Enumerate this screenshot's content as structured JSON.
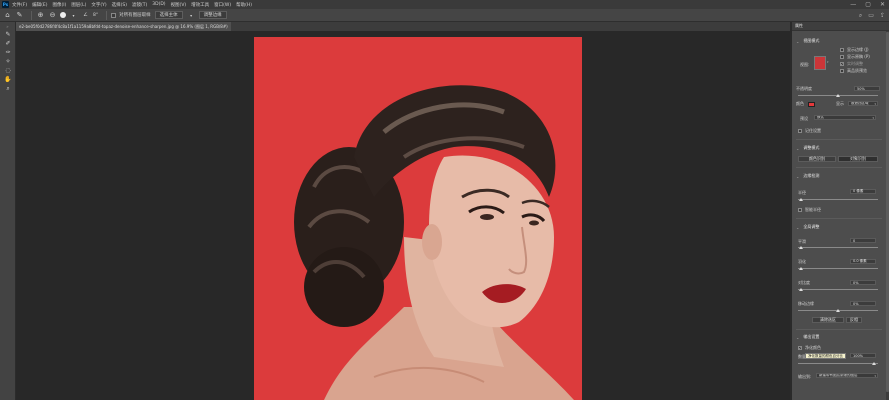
{
  "menubar": {
    "logo": "Ps",
    "items": [
      "文件(F)",
      "编辑(E)",
      "图像(I)",
      "图层(L)",
      "文字(Y)",
      "选择(S)",
      "滤镜(T)",
      "3D(D)",
      "视图(V)",
      "增效工具",
      "窗口(W)",
      "帮助(H)"
    ],
    "controls": [
      "—",
      "▢",
      "✕"
    ]
  },
  "options": {
    "size_value": "8°",
    "sample_button": "对所有图层取样",
    "select_subject": "选择主体",
    "refine_edge": "调整边缘"
  },
  "document": {
    "tab_title": "e2-be05f0d2786f4f4c8a1f1a1159a8bfdd-topaz-denoise-enhance-sharpen.jpg @ 16.9% (图层 1, RGB/8#)",
    "close": "×"
  },
  "panel": {
    "title": "属性",
    "view_mode": "视图模式",
    "show_edge": "显示边缘 (J)",
    "show_original": "显示原稿 (P)",
    "realtime": "实时调整",
    "high_quality": "高品质预览",
    "view_label": "视图:",
    "transparency_label": "不透明度",
    "transparency_value": "50%",
    "color_label": "颜色",
    "show_label": "显示",
    "show_value": "被遮挡区域",
    "preset_label": "预设",
    "preset_value": "默认",
    "remember": "记住设置",
    "adjust_mode": "调整模式",
    "color_aware": "颜色识别",
    "object_aware": "对象识别",
    "edge_detection": "边缘检测",
    "radius_label": "半径",
    "radius_value": "0 像素",
    "smart_radius": "智能半径",
    "global_refine": "全局调整",
    "smooth_label": "平滑",
    "smooth_value": "0",
    "feather_label": "羽化",
    "feather_value": "0.0 像素",
    "contrast_label": "对比度",
    "contrast_value": "0%",
    "shift_label": "移动边缘",
    "shift_value": "0%",
    "clear_selection": "清除选区",
    "invert": "反相",
    "output_settings": "输出设置",
    "decontaminate": "净化颜色",
    "tooltip": "净化数量的颜色百分比",
    "amount_label": "数量",
    "amount_value": "100%",
    "output_to_label": "输出到:",
    "output_to_value": "新建带有图层蒙版的图层"
  },
  "colors": {
    "canvas_bg": "#dc3b3c",
    "overlay_swatch": "#e5393b"
  }
}
